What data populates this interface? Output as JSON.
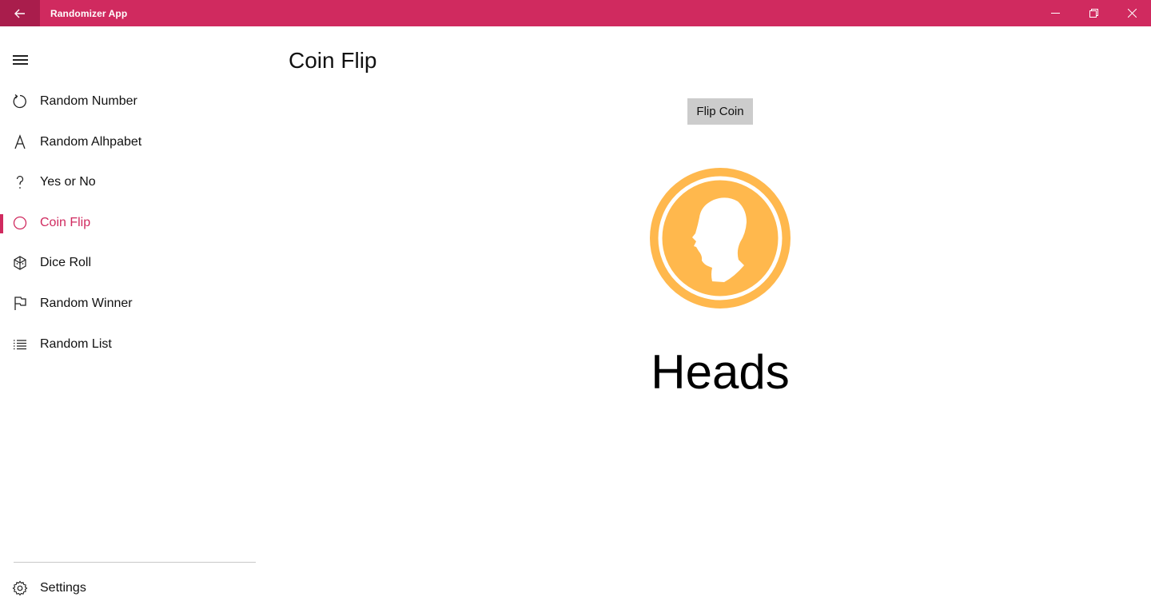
{
  "window": {
    "title": "Randomizer App",
    "accent": "#d02a5f",
    "back_icon": "back-arrow-icon",
    "controls": [
      "minimize-icon",
      "restore-icon",
      "close-icon"
    ]
  },
  "sidebar": {
    "menu_icon": "hamburger-icon",
    "items": [
      {
        "label": "Random Number",
        "icon": "refresh-icon",
        "active": false
      },
      {
        "label": "Random Alhpabet",
        "icon": "letter-a-icon",
        "active": false
      },
      {
        "label": "Yes or No",
        "icon": "question-icon",
        "active": false
      },
      {
        "label": "Coin Flip",
        "icon": "circle-icon",
        "active": true
      },
      {
        "label": "Dice Roll",
        "icon": "dice-icon",
        "active": false
      },
      {
        "label": "Random Winner",
        "icon": "flag-icon",
        "active": false
      },
      {
        "label": "Random List",
        "icon": "list-icon",
        "active": false
      }
    ],
    "settings": {
      "label": "Settings",
      "icon": "gear-icon"
    }
  },
  "main": {
    "title": "Coin Flip",
    "flip_button": "Flip Coin",
    "coin": {
      "face": "heads",
      "color": "#ffb84d"
    },
    "result": "Heads"
  }
}
